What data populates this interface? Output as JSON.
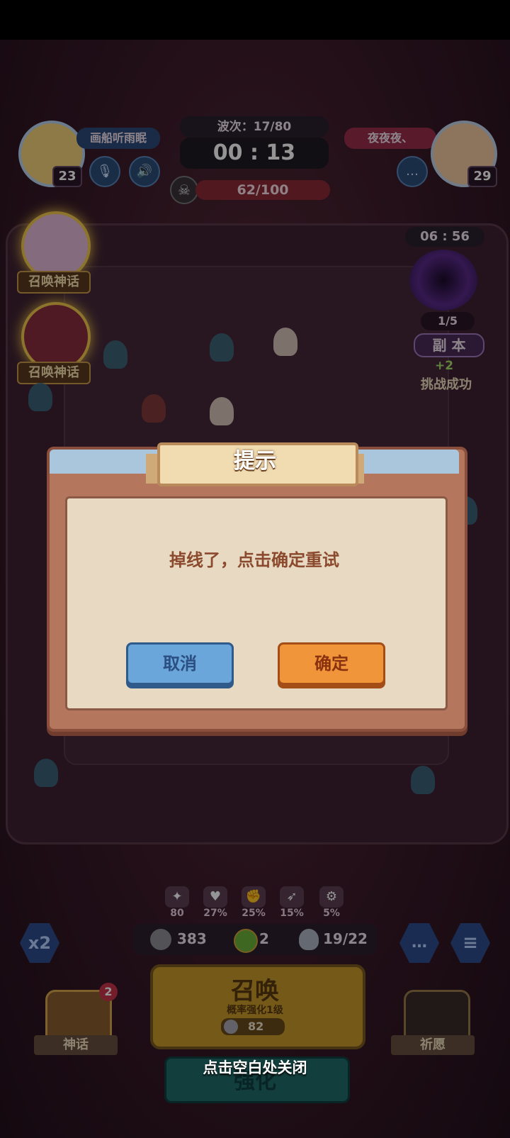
{
  "top": {
    "player_left": {
      "name": "画船听雨眠",
      "level": "23"
    },
    "player_right": {
      "name": "夜夜夜、",
      "level": "29"
    },
    "wave_label": "波次：17/80",
    "timer": "00 : 13",
    "enemy_count": "62/100"
  },
  "side": {
    "summon_myth_1": "召唤神话",
    "summon_myth_2": "召唤神话",
    "dungeon_timer": "06 : 56",
    "dungeon_count": "1/5",
    "dungeon_label": "副 本",
    "challenge_reward": "+2",
    "challenge_success": "挑战成功"
  },
  "stats": [
    "80",
    "27%",
    "25%",
    "15%",
    "5%"
  ],
  "resources": {
    "coins": "383",
    "clover": "2",
    "units": "19/22"
  },
  "bottom": {
    "speed_badge": "x2",
    "myth_label": "神话",
    "myth_badge": "2",
    "summon_title": "召唤",
    "summon_sub": "概率强化1级",
    "summon_cost": "82",
    "enhance_label": "强化",
    "wish_label": "祈愿"
  },
  "dialog": {
    "title": "提示",
    "message": "掉线了，点击确定重试",
    "cancel_label": "取消",
    "confirm_label": "确定"
  },
  "close_hint": "点击空白处关闭",
  "colors": {
    "dialog_frame": "#b5765e",
    "cancel_blue": "#6aa6d9",
    "confirm_orange": "#f0953a"
  }
}
